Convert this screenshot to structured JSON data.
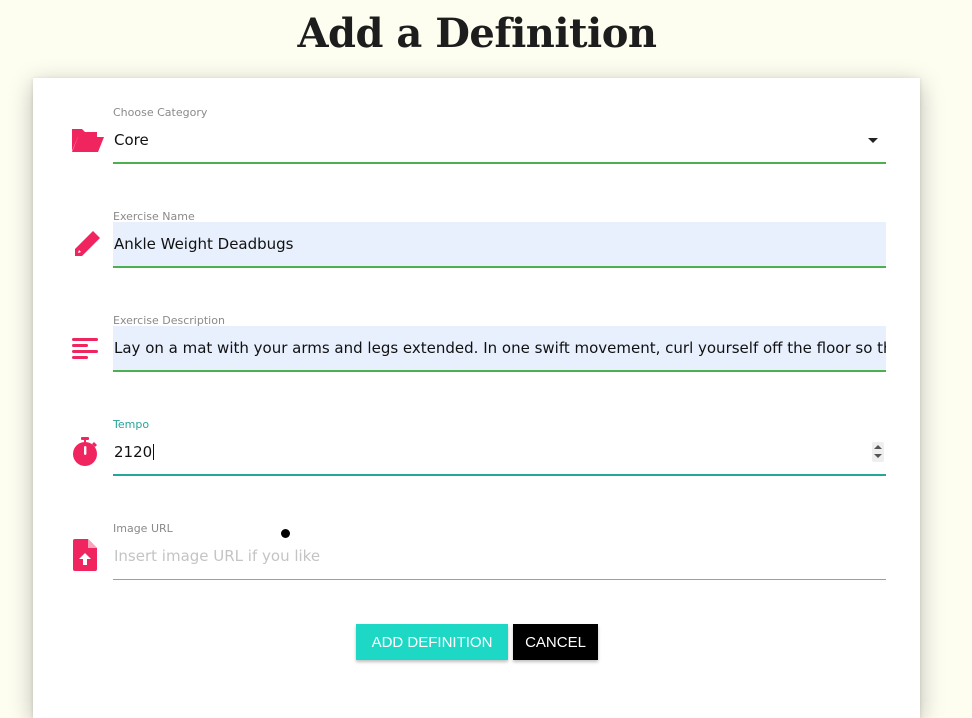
{
  "page": {
    "title": "Add a Definition"
  },
  "form": {
    "category": {
      "label": "Choose Category",
      "value": "Core",
      "icon": "folder-open-icon"
    },
    "exercise_name": {
      "label": "Exercise Name",
      "value": "Ankle Weight Deadbugs",
      "icon": "pencil-icon"
    },
    "exercise_description": {
      "label": "Exercise Description",
      "value": "Lay on a mat with your arms and legs extended. In one swift movement, curl yourself off the floor so that only",
      "icon": "align-left-icon"
    },
    "tempo": {
      "label": "Tempo",
      "value": "2120",
      "icon": "stopwatch-icon"
    },
    "image_url": {
      "label": "Image URL",
      "placeholder": "Insert image URL if you like",
      "icon": "file-upload-icon"
    }
  },
  "buttons": {
    "add": "ADD DEFINITION",
    "cancel": "CANCEL"
  },
  "colors": {
    "icon": "#f0245f",
    "underline_valid": "#4caf50",
    "underline_focus": "#26a69a",
    "add_button": "#1ed8c6",
    "cancel_button": "#000000",
    "autofill_bg": "#e8f0fe"
  }
}
